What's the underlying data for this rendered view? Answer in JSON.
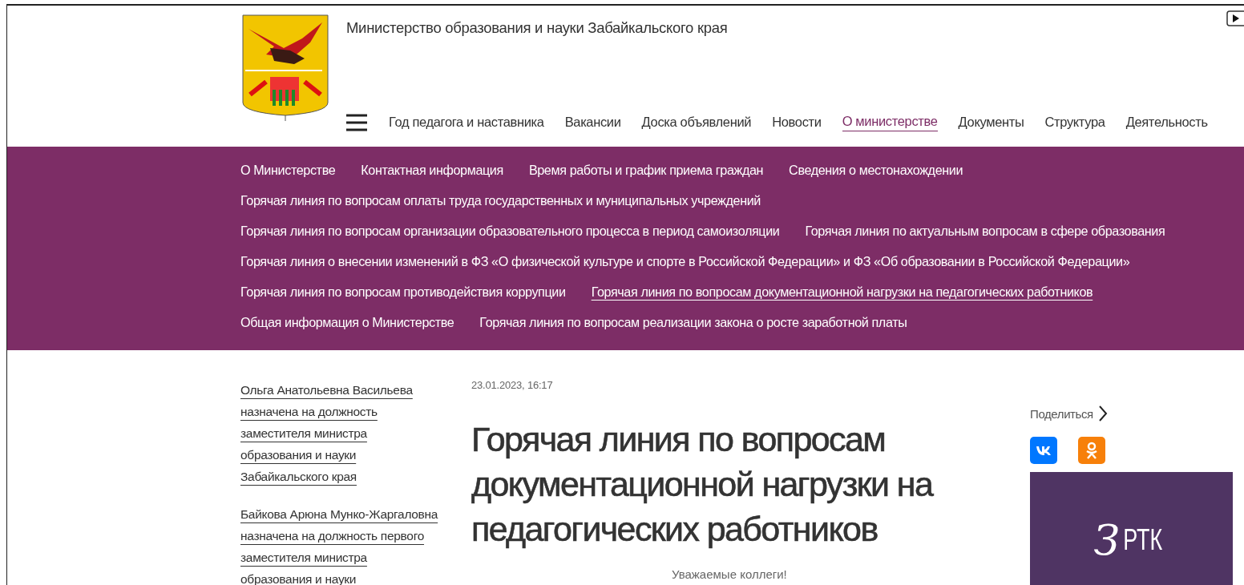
{
  "header": {
    "org_title": "Министерство образования и науки Забайкальского края",
    "nav": [
      {
        "label": "Год педагога и наставника",
        "selected": false
      },
      {
        "label": "Вакансии",
        "selected": false
      },
      {
        "label": "Доска объявлений",
        "selected": false
      },
      {
        "label": "Новости",
        "selected": false
      },
      {
        "label": "О министерстве",
        "selected": true
      },
      {
        "label": "Документы",
        "selected": false
      },
      {
        "label": "Структура",
        "selected": false
      },
      {
        "label": "Деятельность",
        "selected": false
      }
    ]
  },
  "submenu": {
    "rows": [
      {
        "items": [
          {
            "label": "О Министерстве",
            "selected": false
          },
          {
            "label": "Контактная информация",
            "selected": false
          },
          {
            "label": "Время работы и график приема граждан",
            "selected": false
          },
          {
            "label": "Сведения о местонахождении",
            "selected": false
          }
        ]
      },
      {
        "items": [
          {
            "label": "Горячая линия по вопросам оплаты труда государственных и муниципальных учреждений",
            "selected": false
          }
        ]
      },
      {
        "items": [
          {
            "label": "Горячая линия по вопросам организации образовательного процесса в период самоизоляции",
            "selected": false
          },
          {
            "label": "Горячая линия по актуальным вопросам в сфере образования",
            "selected": false
          }
        ]
      },
      {
        "items": [
          {
            "label": "Горячая линия о внесении изменений в ФЗ «О физической культуре и спорте в Российской Федерации» и ФЗ «Об образовании в Российской Федерации»",
            "selected": false
          }
        ]
      },
      {
        "items": [
          {
            "label": "Горячая линия по вопросам противодействия коррупции",
            "selected": false
          },
          {
            "label": "Горячая линия по вопросам документационной нагрузки на педагогических работников",
            "selected": true
          }
        ]
      },
      {
        "items": [
          {
            "label": "Общая информация о Министерстве",
            "selected": false
          },
          {
            "label": "Горячая линия по вопросам реализации закона о росте заработной платы",
            "selected": false
          }
        ]
      }
    ]
  },
  "sidebar": {
    "news": [
      "Ольга Анатольевна Васильева назначена на должность заместителя министра образования и науки Забайкальского края",
      "Байкова Арюна Мунко-Жаргаловна назначена на должность первого заместителя министра образования и науки"
    ]
  },
  "article": {
    "date": "23.01.2023, 16:17",
    "title": "Горячая линия по вопросам документационной нагрузки на педагогических работников",
    "greeting": "Уважаемые коллеги!"
  },
  "share": {
    "label": "Поделиться",
    "networks": [
      {
        "kind": "vk"
      },
      {
        "kind": "ok"
      }
    ]
  },
  "banner": {
    "mark": "З",
    "text": "РТК"
  }
}
